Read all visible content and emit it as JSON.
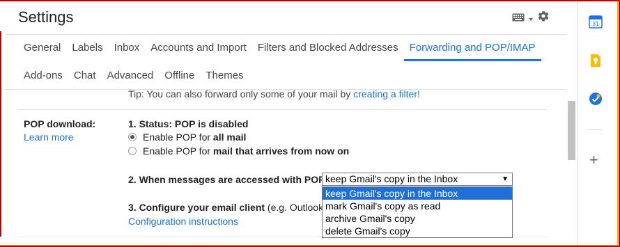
{
  "page": {
    "title": "Settings"
  },
  "tabs_row1": [
    "General",
    "Labels",
    "Inbox",
    "Accounts and Import",
    "Filters and Blocked Addresses",
    "Forwarding and POP/IMAP"
  ],
  "tabs_row2": [
    "Add-ons",
    "Chat",
    "Advanced",
    "Offline",
    "Themes"
  ],
  "active_tab": "Forwarding and POP/IMAP",
  "tip": {
    "prefix": "Tip: You can also forward only some of your mail by ",
    "link": "creating a filter!"
  },
  "pop": {
    "label": "POP download:",
    "learn_more": "Learn more",
    "status": "1. Status: POP is disabled",
    "option1_prefix": "Enable POP for ",
    "option1_bold": "all mail",
    "option2_prefix": "Enable POP for ",
    "option2_bold": "mail that arrives from now on",
    "selected_option": 1,
    "step2_label": "2. When messages are accessed with POP",
    "select_value": "keep Gmail's copy in the Inbox",
    "select_options": [
      "keep Gmail's copy in the Inbox",
      "mark Gmail's copy as read",
      "archive Gmail's copy",
      "delete Gmail's copy"
    ],
    "step3_bold": "3. Configure your email client",
    "step3_rest": " (e.g. Outlook",
    "config_link": "Configuration instructions"
  },
  "icons": {
    "keyboard": "keyboard-icon",
    "gear": "gear-icon",
    "calendar": "calendar-icon",
    "keep": "keep-icon",
    "tasks": "tasks-icon",
    "add": "plus-icon"
  },
  "side": {
    "calendar_day": "31",
    "plus": "+"
  },
  "colors": {
    "accent": "#1a73e8",
    "select_highlight": "#1e6fd9",
    "frame": "#c00000"
  }
}
